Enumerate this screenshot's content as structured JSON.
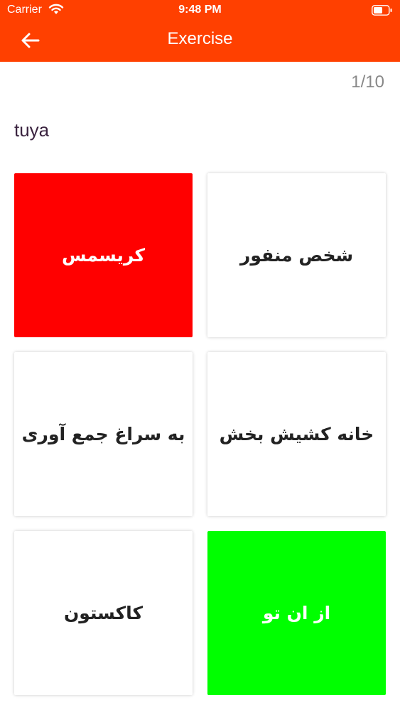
{
  "status_bar": {
    "carrier": "Carrier",
    "time": "9:48 PM"
  },
  "header": {
    "title": "Exercise",
    "background_color": "#ff4000"
  },
  "progress": "1/10",
  "word": "tuya",
  "options": [
    {
      "text": "کریسمس",
      "state": "incorrect",
      "color": "#ff0000"
    },
    {
      "text": "شخص منفور",
      "state": "neutral",
      "color": "#ffffff"
    },
    {
      "text": "به سراغ جمع آوری",
      "state": "neutral",
      "color": "#ffffff"
    },
    {
      "text": "خانه کشیش بخش",
      "state": "neutral",
      "color": "#ffffff"
    },
    {
      "text": "کاکستون",
      "state": "neutral",
      "color": "#ffffff"
    },
    {
      "text": "از ان تو",
      "state": "correct",
      "color": "#00ff00"
    }
  ]
}
